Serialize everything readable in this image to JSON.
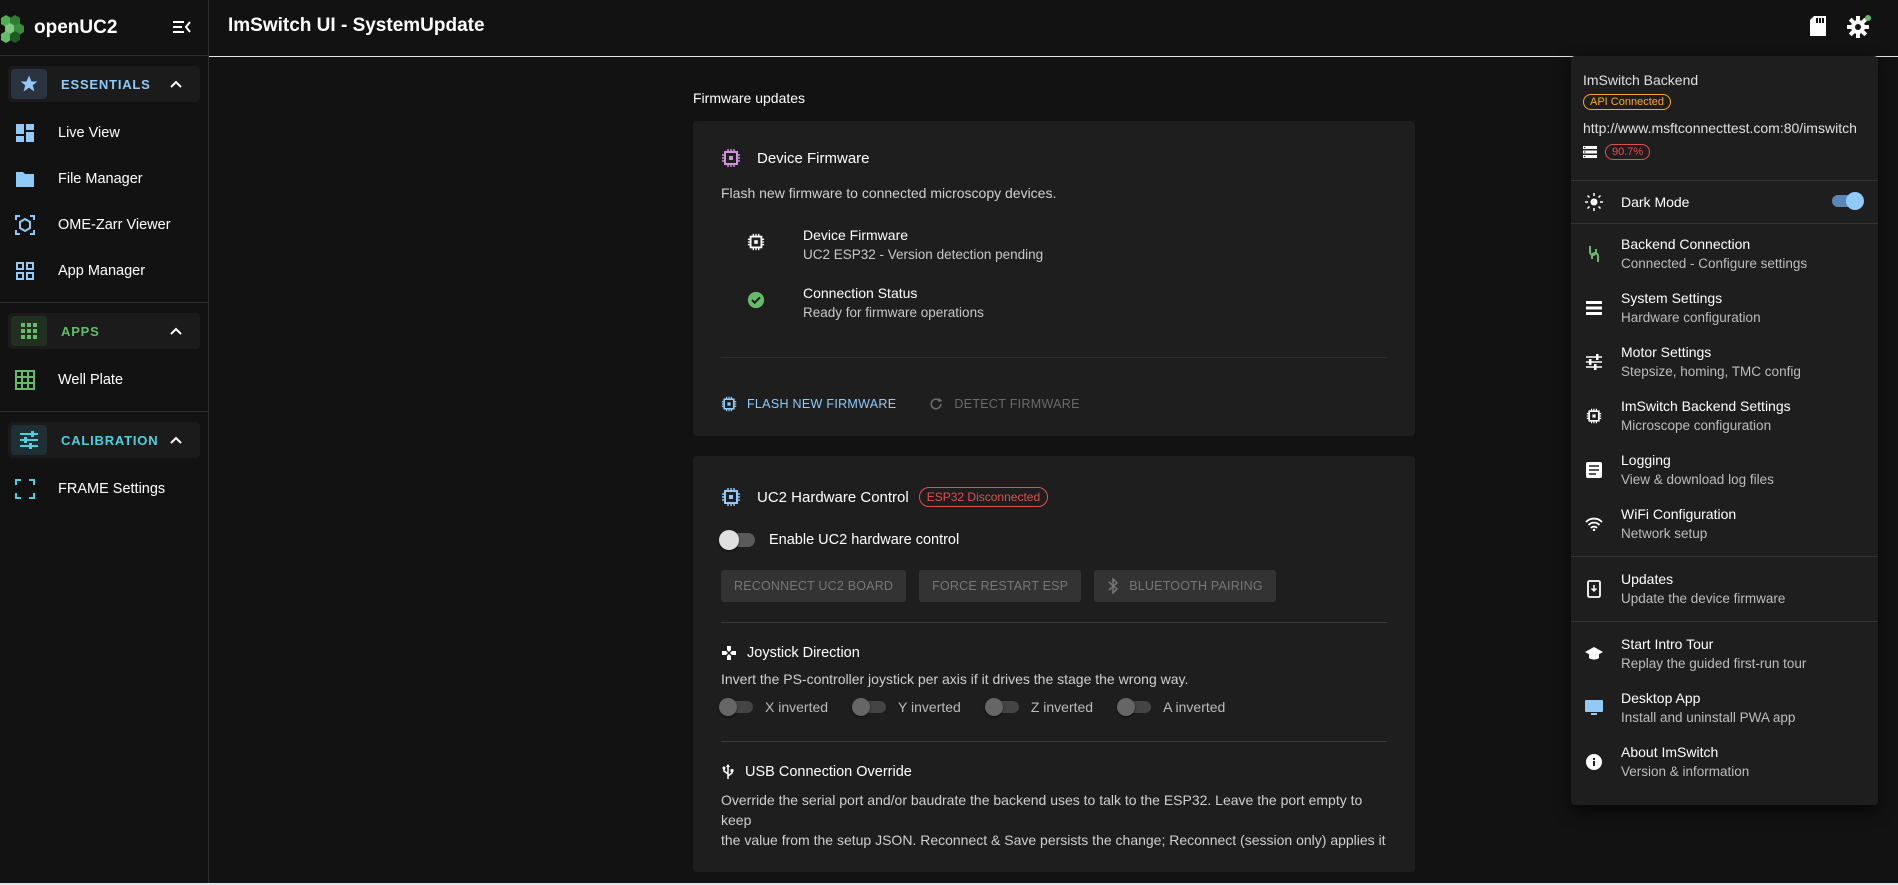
{
  "brand": {
    "name": "openUC2"
  },
  "topbar": {
    "title": "ImSwitch UI - SystemUpdate"
  },
  "sidebar": {
    "sections": [
      {
        "label": "ESSENTIALS",
        "color": "#90caf9"
      },
      {
        "label": "APPS",
        "color": "#66bb6a"
      },
      {
        "label": "CALIBRATION",
        "color": "#4dd0e1"
      }
    ],
    "essentials": [
      "Live View",
      "File Manager",
      "OME-Zarr Viewer",
      "App Manager"
    ],
    "apps": [
      "Well Plate"
    ],
    "calibration": [
      "FRAME Settings"
    ]
  },
  "main": {
    "section_title": "Firmware updates",
    "device_firmware": {
      "title": "Device Firmware",
      "description": "Flash new firmware to connected microscopy devices.",
      "rows": [
        {
          "primary": "Device Firmware",
          "secondary": "UC2 ESP32 - Version detection pending"
        },
        {
          "primary": "Connection Status",
          "secondary": "Ready for firmware operations"
        }
      ],
      "flash_label": "FLASH NEW FIRMWARE",
      "detect_label": "DETECT FIRMWARE"
    },
    "hardware": {
      "title": "UC2 Hardware Control",
      "status_badge": "ESP32 Disconnected",
      "enable_label": "Enable UC2 hardware control",
      "buttons": [
        "RECONNECT UC2 BOARD",
        "FORCE RESTART ESP",
        "BLUETOOTH PAIRING"
      ],
      "joystick_title": "Joystick Direction",
      "joystick_desc": "Invert the PS-controller joystick per axis if it drives the stage the wrong way.",
      "inversions": [
        "X inverted",
        "Y inverted",
        "Z inverted",
        "A inverted"
      ],
      "usb_title": "USB Connection Override",
      "usb_desc_1": "Override the serial port and/or baudrate the backend uses to talk to the ESP32. Leave the port empty to keep",
      "usb_desc_2": "the value from the setup JSON. Reconnect & Save persists the change; Reconnect (session only) applies it"
    }
  },
  "menu": {
    "header_title": "ImSwitch Backend",
    "api_status": "API Connected",
    "url": "http://www.msftconnecttest.com:80/imswitch",
    "storage_percent": "90.7%",
    "dark_mode_label": "Dark Mode",
    "dark_mode_on": true,
    "items": [
      {
        "primary": "Backend Connection",
        "secondary": "Connected - Configure settings"
      },
      {
        "primary": "System Settings",
        "secondary": "Hardware configuration"
      },
      {
        "primary": "Motor Settings",
        "secondary": "Stepsize, homing, TMC config"
      },
      {
        "primary": "ImSwitch Backend Settings",
        "secondary": "Microscope configuration"
      },
      {
        "primary": "Logging",
        "secondary": "View & download log files"
      },
      {
        "primary": "WiFi Configuration",
        "secondary": "Network setup"
      },
      {
        "primary": "Updates",
        "secondary": "Update the device firmware"
      },
      {
        "primary": "Start Intro Tour",
        "secondary": "Replay the guided first-run tour"
      },
      {
        "primary": "Desktop App",
        "secondary": "Install and uninstall PWA app"
      },
      {
        "primary": "About ImSwitch",
        "secondary": "Version & information"
      }
    ]
  },
  "colors": {
    "accent": "#90caf9",
    "success": "#66bb6a",
    "error": "#e05050",
    "warning": "#ffa726",
    "chip": "#ce93d8"
  }
}
